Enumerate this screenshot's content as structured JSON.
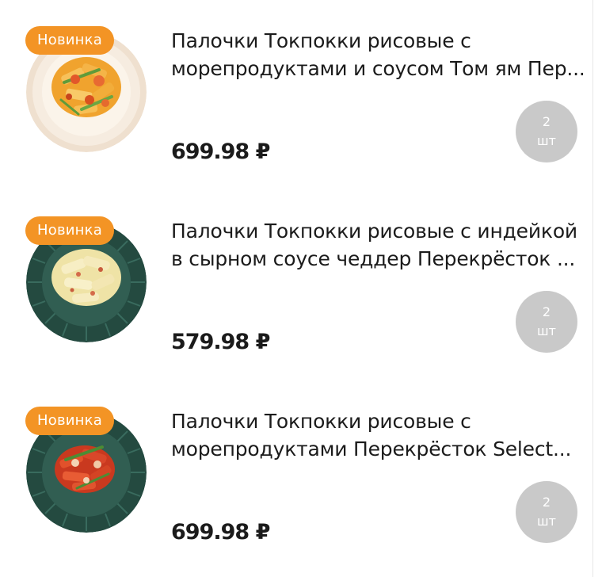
{
  "products": [
    {
      "badge": "Новинка",
      "title_line1": "Палочки Токпокки рисовые с",
      "title_line2": "морепродуктами и соусом Том ям Пер...",
      "price": "699.98 ₽",
      "qty_value": "2",
      "qty_unit": "шт",
      "image_icon": "tteokbokki-seafood-tomyum-plate-icon",
      "plate_color": "#f4e2cf"
    },
    {
      "badge": "Новинка",
      "title_line1": "Палочки Токпокки рисовые с индейкой",
      "title_line2": "в сырном соусе чеддер Перекрёсток ...",
      "price": "579.98 ₽",
      "qty_value": "2",
      "qty_unit": "шт",
      "image_icon": "tteokbokki-turkey-cheddar-plate-icon",
      "plate_color": "#2f5a4e"
    },
    {
      "badge": "Новинка",
      "title_line1": "Палочки Токпокки рисовые с",
      "title_line2": "морепродуктами Перекрёсток Select...",
      "price": "699.98 ₽",
      "qty_value": "2",
      "qty_unit": "шт",
      "image_icon": "tteokbokki-seafood-plate-icon",
      "plate_color": "#2f5a4e"
    }
  ],
  "colors": {
    "badge": "#f39425",
    "qty_circle": "#c9c9c9",
    "text": "#1b1b1b"
  }
}
